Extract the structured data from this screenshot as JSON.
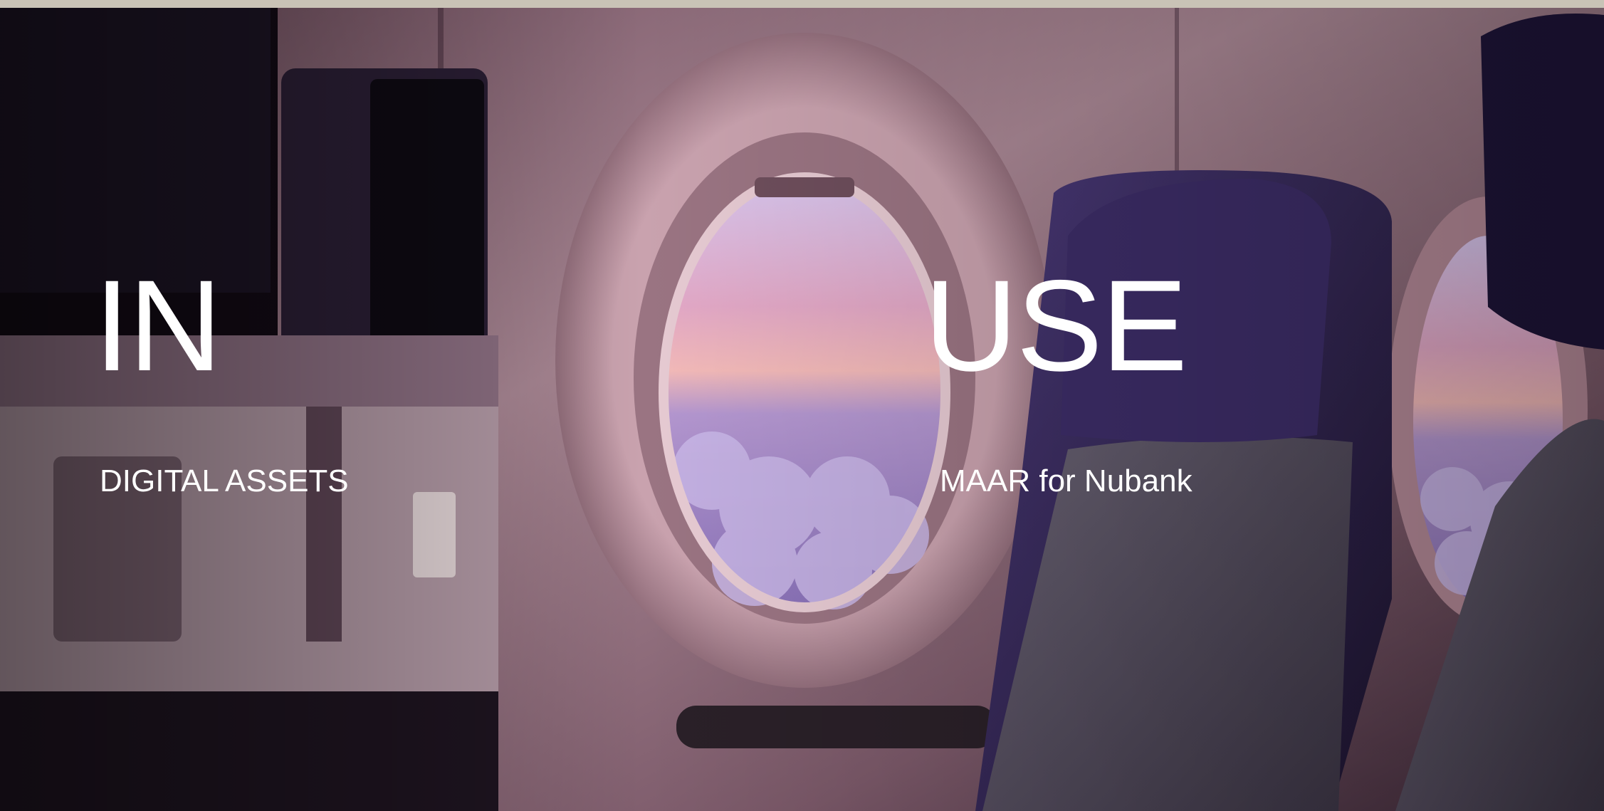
{
  "hero": {
    "headline_left": "IN",
    "headline_right": "USE",
    "subtitle_left": "DIGITAL ASSETS",
    "subtitle_right": "MAAR for Nubank"
  },
  "colors": {
    "text": "#ffffff",
    "top_bar": "#c9c3b6",
    "cabin_wall": "#8a6a76",
    "seat": "#3b2a5a"
  }
}
